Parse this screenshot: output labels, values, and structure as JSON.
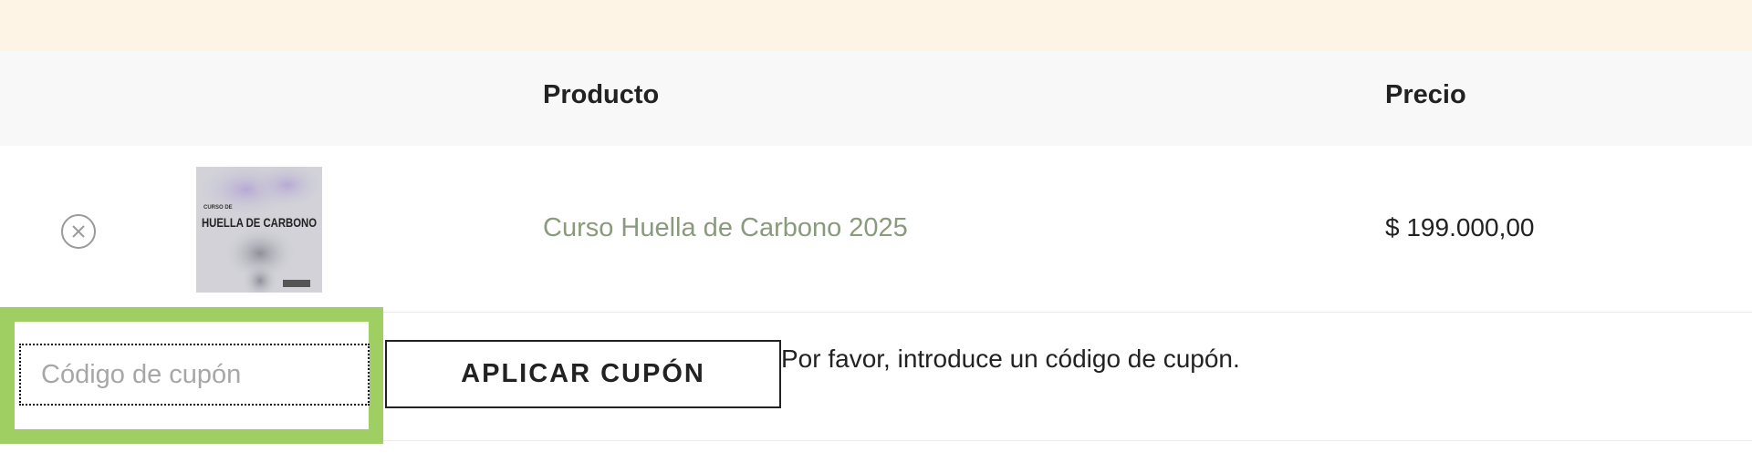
{
  "table": {
    "headers": {
      "product": "Producto",
      "price": "Precio"
    }
  },
  "cart": {
    "items": [
      {
        "name": "Curso Huella de Carbono 2025",
        "price": "$ 199.000,00",
        "thumbnail": {
          "line1": "CURSO DE",
          "line2": "HUELLA DE CARBONO"
        }
      }
    ]
  },
  "coupon": {
    "placeholder": "Código de cupón",
    "value": "",
    "apply_label": "APLICAR CUPÓN",
    "message": "Por favor, introduce un código de cupón."
  },
  "colors": {
    "notice_bg": "#fdf4e6",
    "header_bg": "#f8f8f8",
    "link_green": "#8a9a7c",
    "focus_highlight": "#9fce63"
  },
  "icons": {
    "remove": "close-circle-icon"
  }
}
